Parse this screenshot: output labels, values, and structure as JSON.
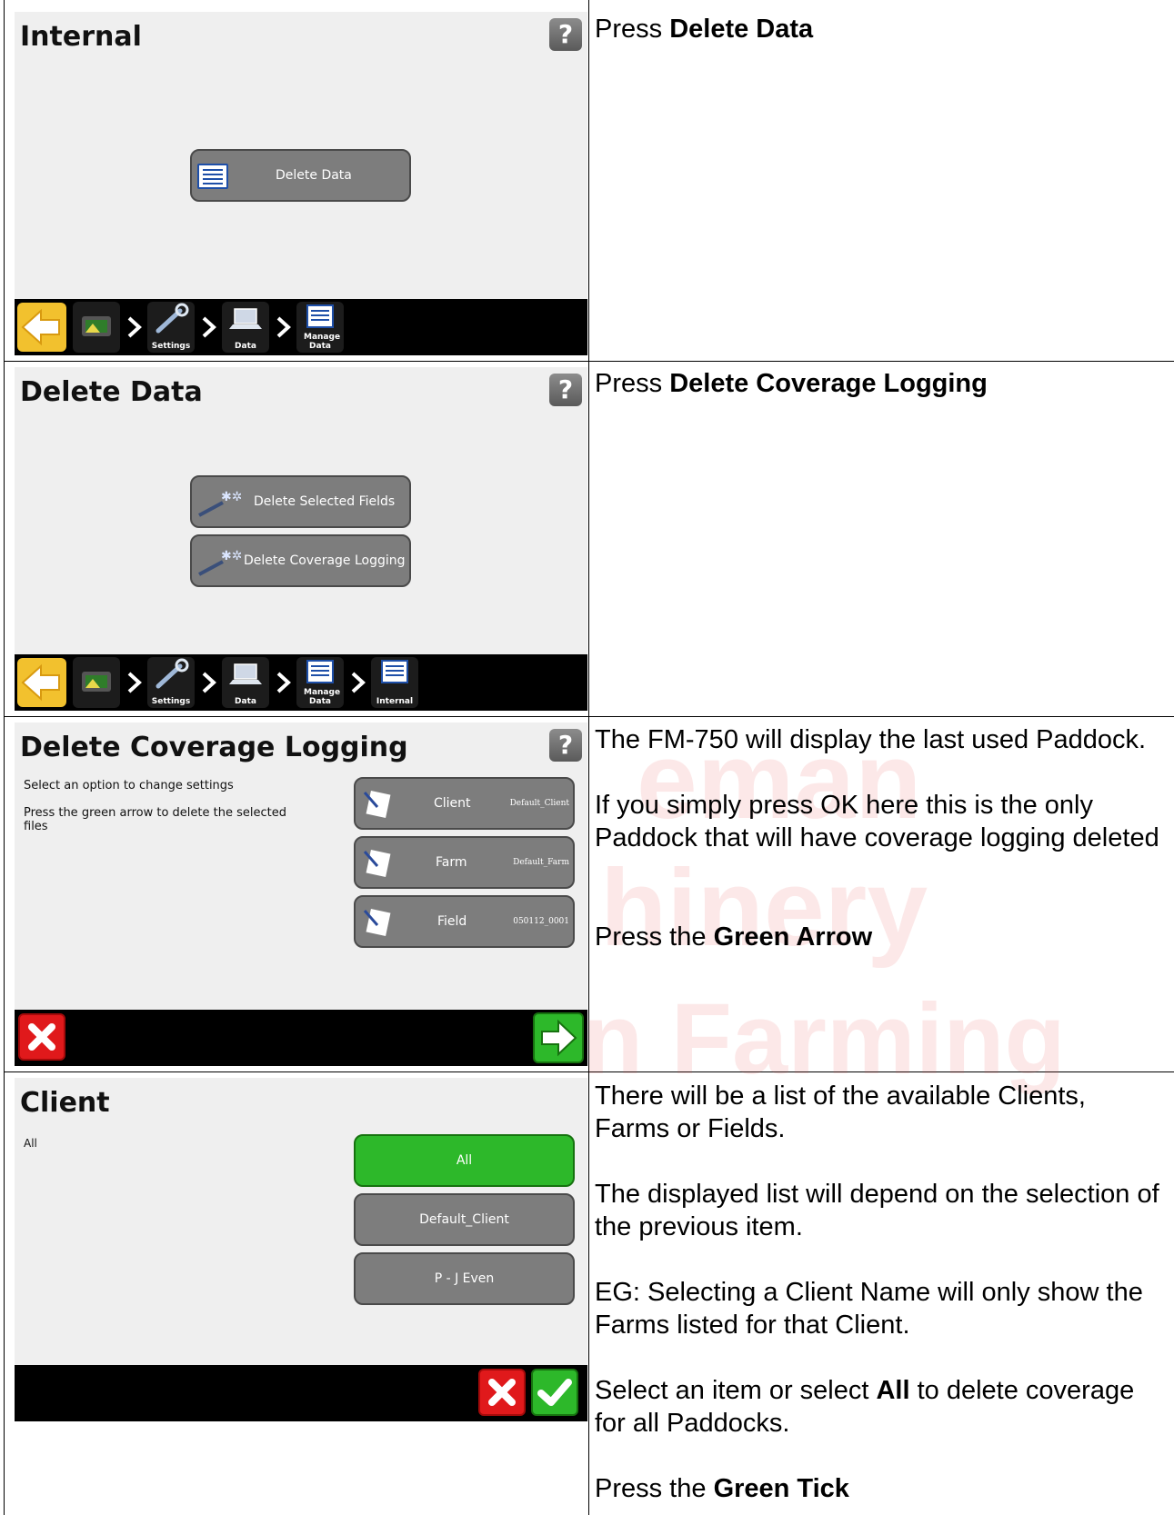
{
  "rows": [
    {
      "screen": {
        "title": "Internal",
        "help": "?",
        "buttons": [
          "Delete Data"
        ],
        "breadcrumbs": [
          "Settings",
          "Data",
          "Manage Data"
        ]
      },
      "text": {
        "prefix": "Press ",
        "bold": "Delete Data"
      }
    },
    {
      "screen": {
        "title": "Delete Data",
        "help": "?",
        "buttons": [
          "Delete Selected Fields",
          "Delete Coverage Logging"
        ],
        "breadcrumbs": [
          "Settings",
          "Data",
          "Manage Data",
          "Internal"
        ]
      },
      "text": {
        "prefix": "Press ",
        "bold": "Delete Coverage Logging"
      }
    },
    {
      "screen": {
        "title": "Delete Coverage Logging",
        "help": "?",
        "instructions": [
          "Select an option to change settings",
          "Press the green arrow to delete the selected files"
        ],
        "fields": [
          {
            "label": "Client",
            "value": "Default_Client"
          },
          {
            "label": "Farm",
            "value": "Default_Farm"
          },
          {
            "label": "Field",
            "value": "050112_0001"
          }
        ]
      },
      "text": {
        "p1": "The FM-750 will display the last used Paddock.",
        "p2": "If you simply press OK here this is the only Paddock that will have coverage logging deleted",
        "p3_prefix": "Press the ",
        "p3_bold": "Green Arrow"
      }
    },
    {
      "screen": {
        "title": "Client",
        "current": "All",
        "options": [
          "All",
          "Default_Client",
          "P - J Even"
        ]
      },
      "text": {
        "p1": "There will be a list of the available Clients, Farms or Fields.",
        "p2": "The displayed list will depend on the selection of the previous item.",
        "p3": "EG: Selecting a Client Name will only show the Farms listed for that Client.",
        "p4_prefix": "Select an item or select ",
        "p4_bold": "All",
        "p4_suffix": " to delete coverage for all Paddocks.",
        "p5_prefix": "Press the ",
        "p5_bold": "Green Tick"
      }
    }
  ],
  "watermark": {
    "line1": "eman",
    "line2": "hinery",
    "line3": "n Farming"
  },
  "colors": {
    "accent_green": "#2db82a",
    "cancel_red": "#e0191b",
    "back_yellow": "#f2c12e",
    "button_grey": "#7d7d7d"
  }
}
